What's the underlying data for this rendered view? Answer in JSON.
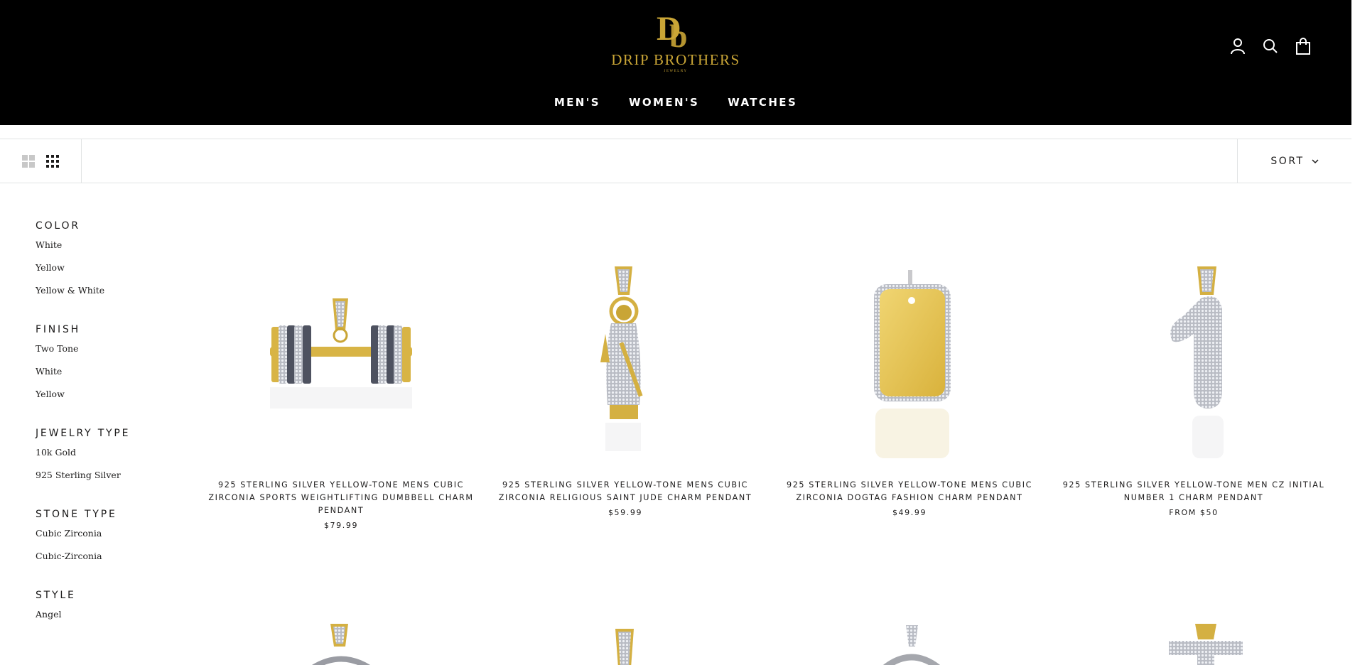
{
  "brand": {
    "name": "DRIP BROTHERS",
    "subtitle": "JEWELRY",
    "monogram": "DB",
    "gold": "#c9a536"
  },
  "nav": [
    {
      "label": "MEN'S"
    },
    {
      "label": "WOMEN'S"
    },
    {
      "label": "WATCHES"
    }
  ],
  "header_icons": [
    "account-icon",
    "search-icon",
    "cart-icon"
  ],
  "toolbar": {
    "sort_label": "SORT"
  },
  "filters": [
    {
      "title": "COLOR",
      "items": [
        "White",
        "Yellow",
        "Yellow & White"
      ]
    },
    {
      "title": "FINISH",
      "items": [
        "Two Tone",
        "White",
        "Yellow"
      ]
    },
    {
      "title": "JEWELRY TYPE",
      "items": [
        "10k Gold",
        "925 Sterling Silver"
      ]
    },
    {
      "title": "STONE TYPE",
      "items": [
        "Cubic Zirconia",
        "Cubic-Zirconia"
      ]
    },
    {
      "title": "STYLE",
      "items": [
        "Angel"
      ]
    }
  ],
  "products": [
    {
      "title": "925 STERLING SILVER YELLOW-TONE MENS CUBIC ZIRCONIA SPORTS WEIGHTLIFTING DUMBBELL CHARM PENDANT",
      "price": "$79.99",
      "shape": "dumbbell"
    },
    {
      "title": "925 STERLING SILVER YELLOW-TONE MENS CUBIC ZIRCONIA RELIGIOUS SAINT JUDE CHARM PENDANT",
      "price": "$59.99",
      "shape": "saint"
    },
    {
      "title": "925 STERLING SILVER YELLOW-TONE MENS CUBIC ZIRCONIA DOGTAG FASHION CHARM PENDANT",
      "price": "$49.99",
      "shape": "dogtag"
    },
    {
      "title": "925 STERLING SILVER YELLOW-TONE MEN CZ INITIAL NUMBER 1 CHARM PENDANT",
      "price": "FROM $50",
      "shape": "number1"
    }
  ],
  "products_row2": [
    "round",
    "bail",
    "oval",
    "cross"
  ]
}
